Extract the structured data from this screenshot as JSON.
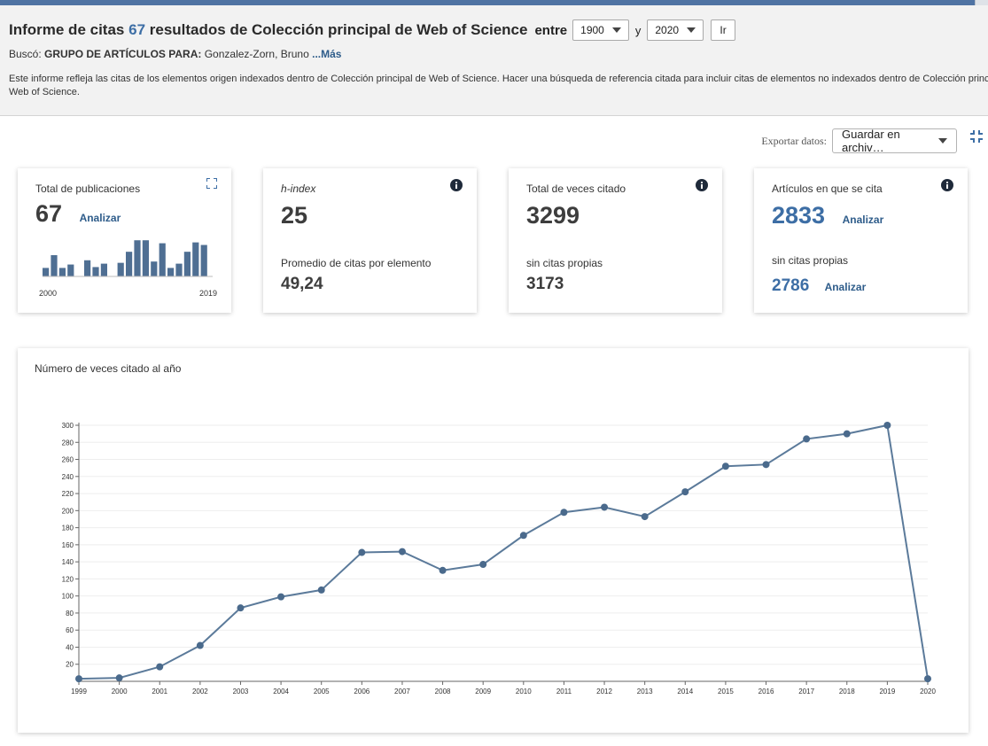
{
  "header": {
    "title_prefix": "Informe de citas",
    "result_count": "67",
    "title_middle": "resultados de Colección principal de Web of Science",
    "between_label": "entre",
    "year_from": "1900",
    "and_label": "y",
    "year_to": "2020",
    "go_label": "Ir",
    "search_prefix": "Buscó:",
    "search_field": "GRUPO DE ARTÍCULOS PARA:",
    "search_value": "Gonzalez-Zorn, Bruno",
    "more_link": "...Más",
    "description_line1": "Este informe refleja las citas de los elementos origen indexados dentro de Colección principal de Web of Science. Hacer una búsqueda de referencia citada para incluir citas de elementos no indexados dentro de Colección principal de",
    "description_line2": "Web of Science."
  },
  "export": {
    "label": "Exportar datos:",
    "selected": "Guardar en archiv…"
  },
  "cards": {
    "publications": {
      "label": "Total de publicaciones",
      "value": "67",
      "link": "Analizar",
      "axis_start": "2000",
      "axis_end": "2019",
      "mini_bars": [
        0.2,
        0.5,
        0.2,
        0.28,
        0,
        0.38,
        0.22,
        0.3,
        0,
        0.32,
        0.58,
        0.85,
        0.85,
        0.35,
        0.78,
        0.2,
        0.3,
        0.58,
        0.8,
        0.74
      ]
    },
    "hindex": {
      "label": "h-index",
      "value": "25",
      "sub_label": "Promedio de citas por elemento",
      "sub_value": "49,24"
    },
    "times_cited": {
      "label": "Total de veces citado",
      "value": "3299",
      "sub_label": "sin citas propias",
      "sub_value": "3173"
    },
    "citing_articles": {
      "label": "Artículos en que se cita",
      "value": "2833",
      "link": "Analizar",
      "sub_label": "sin citas propias",
      "sub_value": "2786",
      "sub_link": "Analizar"
    }
  },
  "colors": {
    "accent": "#3d6ea5",
    "series": "#5b7a9a",
    "bars": "#4f6f93"
  },
  "chart_data": {
    "type": "line",
    "title": "Número de veces citado al año",
    "x": [
      "1999",
      "2000",
      "2001",
      "2002",
      "2003",
      "2004",
      "2005",
      "2006",
      "2007",
      "2008",
      "2009",
      "2010",
      "2011",
      "2012",
      "2013",
      "2014",
      "2015",
      "2016",
      "2017",
      "2018",
      "2019",
      "2020"
    ],
    "series": [
      {
        "values": [
          3,
          4,
          17,
          42,
          86,
          99,
          107,
          151,
          152,
          130,
          137,
          171,
          198,
          204,
          193,
          222,
          252,
          254,
          284,
          290,
          300,
          3
        ]
      }
    ],
    "ylim": [
      0,
      300
    ],
    "yticks": [
      20,
      40,
      60,
      80,
      100,
      120,
      140,
      160,
      180,
      200,
      220,
      240,
      260,
      280,
      300
    ],
    "grid": true
  }
}
